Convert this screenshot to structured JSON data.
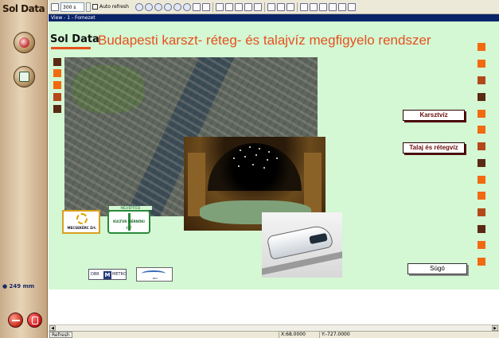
{
  "sidebar": {
    "brand": "Sol Data",
    "zoom_indicator": "249 mm"
  },
  "toolbar": {
    "zoom_value": "300 s",
    "auto_refresh_label": "Auto refresh"
  },
  "view": {
    "title": "View - 1 - Fomezet"
  },
  "canvas": {
    "logo_text": "Sol Data",
    "title": "Budapesti karszt- réteg- és talajvíz megfigyelo rendszer",
    "buttons": {
      "karsztviz": "Karsztvíz",
      "talaj": "Talaj és rétegvíz",
      "sugo": "Súgó"
    },
    "partners": {
      "mecsekerc": "MECSEKÉRC Zrt.",
      "kultur_top": "MÉLYÉPÍTÉSI",
      "kultur_mid": "KULTÚR MÉRNÖKI",
      "kultur_bot": "KFT",
      "dbr_a": "DBR",
      "dbr_m": "M",
      "dbr_b": "METRO",
      "bkv": "BKV"
    }
  },
  "statusbar": {
    "refresh_label": "Refresh",
    "x_readout": "X:68.0000",
    "y_readout": "Y:-727.0000"
  },
  "colors": {
    "accent_orange": "#f26a10",
    "dark_brown": "#5a2a12",
    "canvas_bg": "#d4f7d4",
    "title_orange": "#e6501c"
  }
}
